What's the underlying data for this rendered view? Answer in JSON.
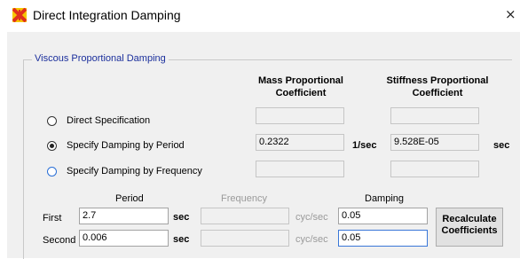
{
  "window": {
    "title": "Direct Integration Damping",
    "close_glyph": "×"
  },
  "group": {
    "label": "Viscous Proportional Damping"
  },
  "columns": {
    "mass": {
      "line1": "Mass Proportional",
      "line2": "Coefficient"
    },
    "stiffness": {
      "line1": "Stiffness Proportional",
      "line2": "Coefficient"
    }
  },
  "options": [
    {
      "label": "Direct Specification",
      "selected": false
    },
    {
      "label": "Specify Damping by Period",
      "selected": true
    },
    {
      "label": "Specify Damping by Frequency",
      "selected": false
    }
  ],
  "coefficients": {
    "direct": {
      "mass": "",
      "stiffness": ""
    },
    "period": {
      "mass": "0.2322",
      "mass_unit": "1/sec",
      "stiffness": "9.528E-05",
      "stiffness_unit": "sec"
    },
    "frequency": {
      "mass": "",
      "stiffness": ""
    }
  },
  "table": {
    "headers": {
      "period": "Period",
      "frequency": "Frequency",
      "damping": "Damping"
    },
    "rows": [
      {
        "label": "First",
        "period": "2.7",
        "period_unit": "sec",
        "frequency": "",
        "frequency_unit": "cyc/sec",
        "damping": "0.05"
      },
      {
        "label": "Second",
        "period": "0.006",
        "period_unit": "sec",
        "frequency": "",
        "frequency_unit": "cyc/sec",
        "damping": "0.05"
      }
    ]
  },
  "buttons": {
    "recalculate_line1": "Recalculate",
    "recalculate_line2": "Coefficients"
  },
  "colors": {
    "group_label": "#1b2f9c",
    "dialog_bg": "#f0f0f0",
    "focus_border": "#3a77d8",
    "icon_red": "#e0301e",
    "icon_yellow": "#f7c600"
  },
  "icons": {
    "app": "damping-app-icon",
    "close": "close-icon"
  }
}
